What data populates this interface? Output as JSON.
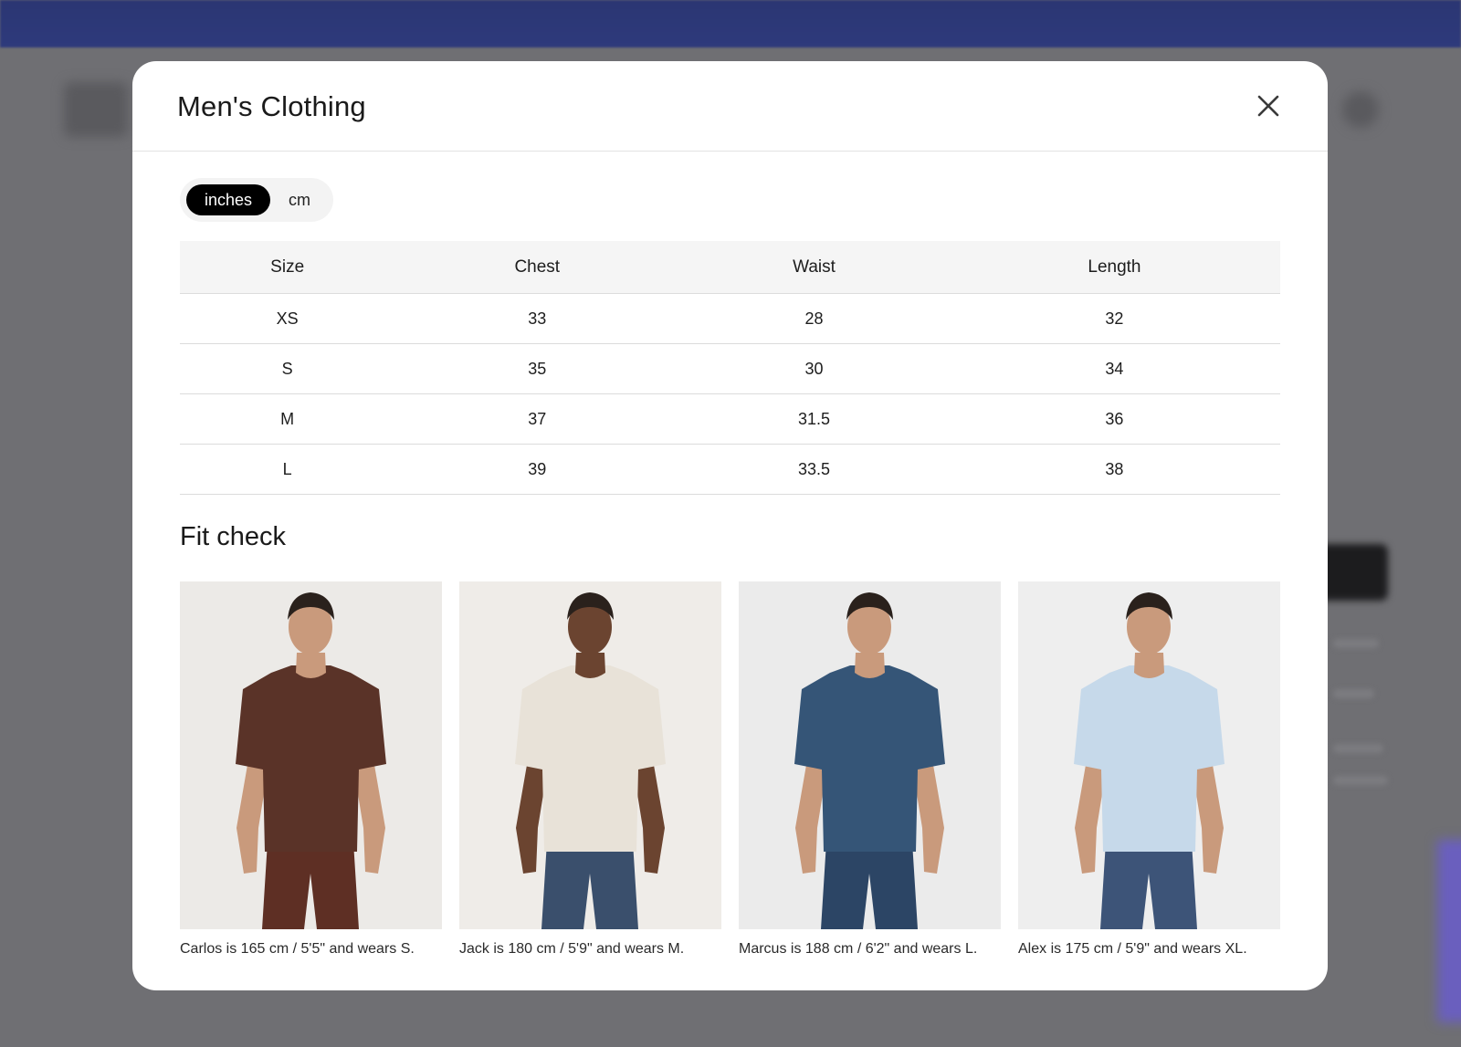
{
  "modal": {
    "title": "Men's Clothing"
  },
  "units": {
    "options": [
      "inches",
      "cm"
    ],
    "selected": "inches"
  },
  "size_chart": {
    "columns": [
      "Size",
      "Chest",
      "Waist",
      "Length"
    ],
    "rows": [
      [
        "XS",
        "33",
        "28",
        "32"
      ],
      [
        "S",
        "35",
        "30",
        "34"
      ],
      [
        "M",
        "37",
        "31.5",
        "36"
      ],
      [
        "L",
        "39",
        "33.5",
        "38"
      ]
    ]
  },
  "fit_check": {
    "heading": "Fit check",
    "models": [
      {
        "caption": "Carlos is 165 cm / 5'5\" and wears S.",
        "shirt_color": "#5a3328",
        "pants_color": "#5e2f24",
        "bg_color": "#eceae7"
      },
      {
        "caption": "Jack is 180 cm / 5'9\" and wears M.",
        "shirt_color": "#e8e2d8",
        "pants_color": "#3a4f6c",
        "bg_color": "#efece8"
      },
      {
        "caption": "Marcus is 188 cm / 6'2\" and wears L.",
        "shirt_color": "#355577",
        "pants_color": "#2c4565",
        "bg_color": "#ebebeb"
      },
      {
        "caption": "Alex is 175 cm / 5'9\" and wears XL.",
        "shirt_color": "#c6d9ea",
        "pants_color": "#3d5478",
        "bg_color": "#eeeeee"
      }
    ]
  }
}
